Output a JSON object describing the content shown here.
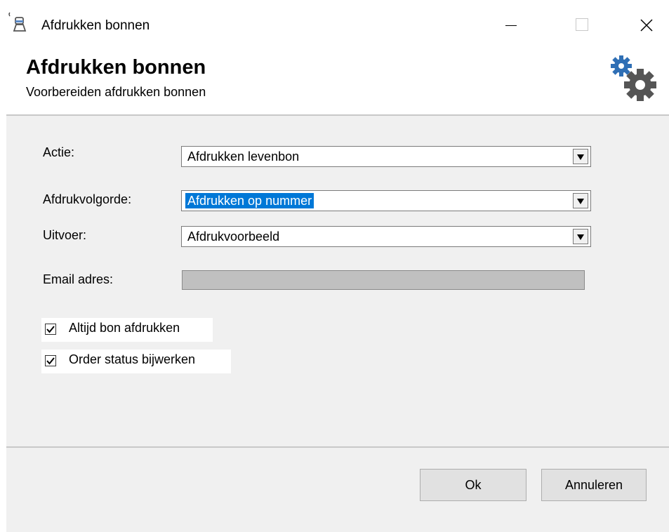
{
  "window": {
    "title": "Afdrukken bonnen",
    "controls": {
      "minimize": "minimize",
      "maximize": "maximize",
      "close": "close"
    }
  },
  "header": {
    "title": "Afdrukken bonnen",
    "subtitle": "Voorbereiden afdrukken bonnen",
    "icon": "gears-icon"
  },
  "form": {
    "actie": {
      "label": "Actie:",
      "value": "Afdrukken levenbon"
    },
    "afdrukvolgorde": {
      "label": "Afdrukvolgorde:",
      "value": "Afdrukken op nummer"
    },
    "uitvoer": {
      "label": "Uitvoer:",
      "value": "Afdrukvoorbeeld"
    },
    "email": {
      "label": "Email adres:",
      "value": "",
      "enabled": false
    }
  },
  "options": [
    {
      "label": "Altijd bon afdrukken",
      "checked": true
    },
    {
      "label": "Order status bijwerken",
      "checked": true
    }
  ],
  "buttons": {
    "ok": "Ok",
    "cancel": "Annuleren"
  },
  "colors": {
    "selection": "#0078d7",
    "panel": "#f0f0f0",
    "disabled_field": "#c0c0c0",
    "gear_blue": "#2f6fb5",
    "gear_grey": "#555555"
  }
}
